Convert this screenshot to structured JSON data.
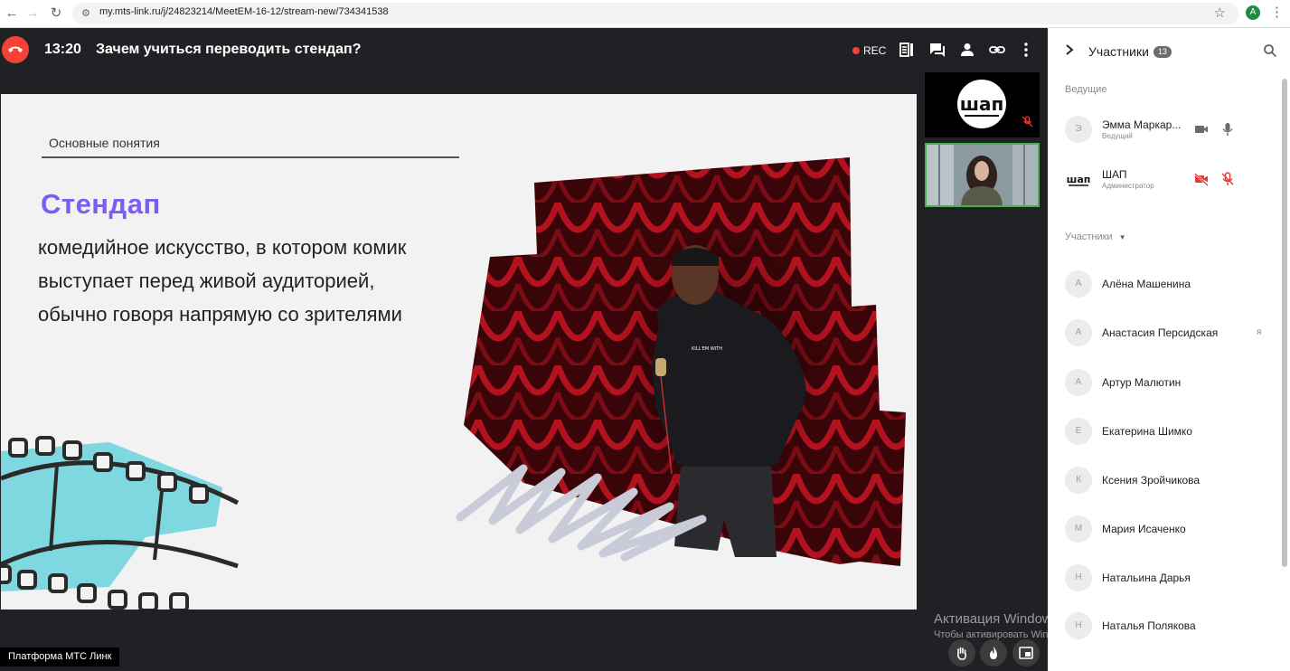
{
  "browser": {
    "url": "my.mts-link.ru/j/24823214/MeetEM-16-12/stream-new/734341538",
    "profile_initial": "A"
  },
  "event": {
    "time": "13:20",
    "title": "Зачем учиться переводить стендап?",
    "rec_label": "REC"
  },
  "slide": {
    "subtitle": "Основные понятия",
    "heading": "Стендап",
    "body": "комедийное искусство, в котором комик выступает перед живой аудиторией, обычно говоря напрямую со зрителями"
  },
  "tiles": {
    "logo_text": "шап"
  },
  "footer": {
    "platform_label": "Платформа МТС Линк",
    "windows_title": "Активация Windows",
    "windows_hint": "Чтобы активировать Windows, перейдите в раздел \"Параметры\"."
  },
  "sidebar": {
    "title": "Участники",
    "count": "13",
    "hosts_label": "Ведущие",
    "hosts": [
      {
        "initial": "Э",
        "name": "Эмма Маркар...",
        "role": "Ведущий"
      },
      {
        "initial": "шап",
        "name": "ШАП",
        "role": "Администратор"
      }
    ],
    "participants_label": "Участники",
    "participants": [
      {
        "initial": "А",
        "name": "Алёна Машенина"
      },
      {
        "initial": "А",
        "name": "Анастасия Персидская",
        "badge": "я"
      },
      {
        "initial": "А",
        "name": "Артур Малютин"
      },
      {
        "initial": "Е",
        "name": "Екатерина Шимко"
      },
      {
        "initial": "К",
        "name": "Ксения Зройчикова"
      },
      {
        "initial": "М",
        "name": "Мария Исаченко"
      },
      {
        "initial": "Н",
        "name": "Натальина Дарья"
      },
      {
        "initial": "Н",
        "name": "Наталья Полякова"
      }
    ]
  },
  "colors": {
    "accent_red": "#f44336",
    "heading_purple": "#7b5cf5",
    "active_tile": "#4caf50",
    "app_bg": "#202124"
  }
}
